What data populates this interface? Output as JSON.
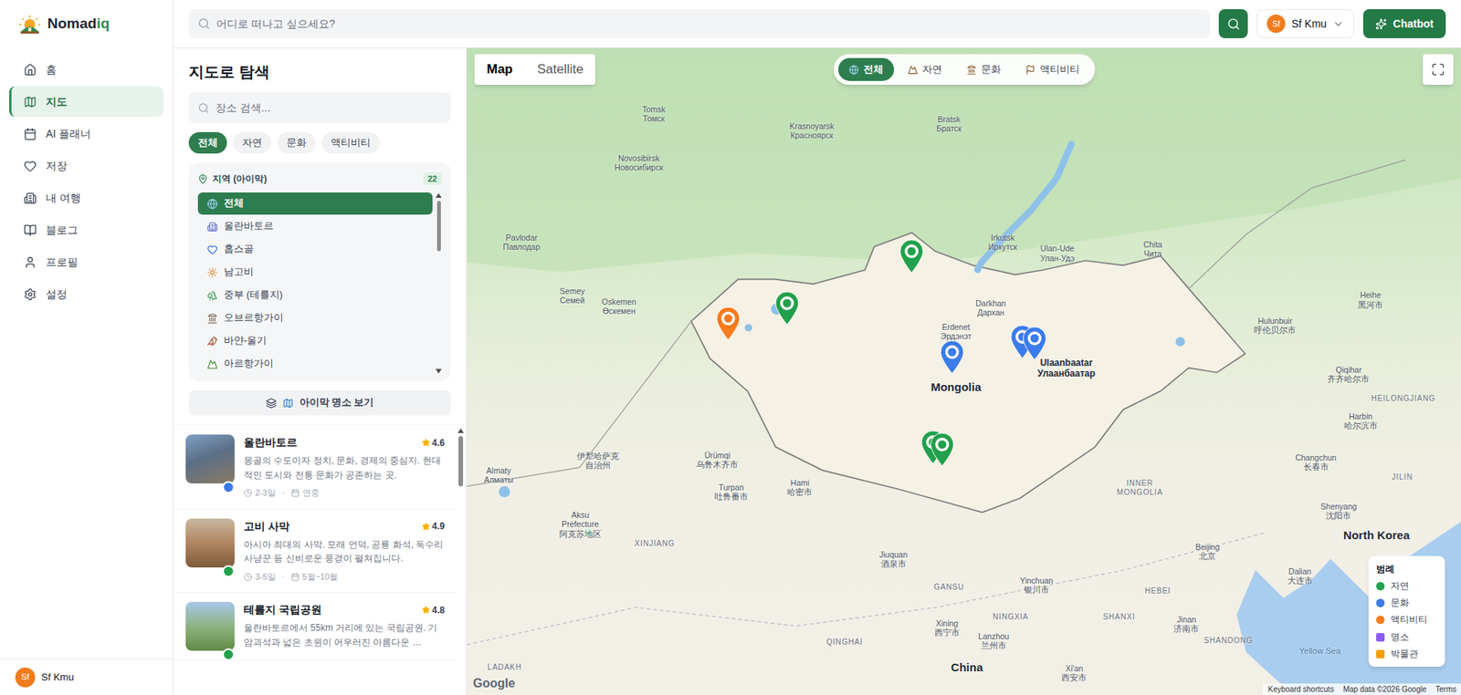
{
  "brand": {
    "name": "Nomad",
    "accent": "iq"
  },
  "nav": [
    {
      "label": "홈",
      "selected": false
    },
    {
      "label": "지도",
      "selected": true
    },
    {
      "label": "AI 플래너",
      "selected": false
    },
    {
      "label": "저장",
      "selected": false
    },
    {
      "label": "내 여행",
      "selected": false
    },
    {
      "label": "블로그",
      "selected": false
    },
    {
      "label": "프로필",
      "selected": false
    },
    {
      "label": "설정",
      "selected": false
    }
  ],
  "sidebar_user": {
    "initials": "Sf",
    "name": "Sf Kmu"
  },
  "topbar": {
    "search_placeholder": "어디로 떠나고 싶으세요?",
    "user": {
      "initials": "Sf",
      "name": "Sf Kmu"
    },
    "chatbot": "Chatbot"
  },
  "panel": {
    "title": "지도로 탐색",
    "search_placeholder": "장소 검색...",
    "filters": [
      {
        "label": "전체",
        "selected": true
      },
      {
        "label": "자연",
        "selected": false
      },
      {
        "label": "문화",
        "selected": false
      },
      {
        "label": "액티비티",
        "selected": false
      }
    ],
    "region": {
      "title": "지역 (아이막)",
      "count": "22",
      "items": [
        {
          "label": "전체",
          "selected": true
        },
        {
          "label": "울란바토르",
          "selected": false
        },
        {
          "label": "홉스골",
          "selected": false
        },
        {
          "label": "남고비",
          "selected": false
        },
        {
          "label": "중부 (테를지)",
          "selected": false
        },
        {
          "label": "오브르항가이",
          "selected": false
        },
        {
          "label": "바얀-울기",
          "selected": false
        },
        {
          "label": "아르항가이",
          "selected": false
        }
      ]
    },
    "aimag_button": "아이막 명소 보기",
    "places": [
      {
        "name": "울란바토르",
        "rating": "4.6",
        "description": "몽골의 수도이자 정치, 문화, 경제의 중심지. 현대적인 도시와 전통 문화가 공존하는 곳.",
        "duration": "2-3일",
        "season": "연중",
        "category_color": "#3b7bea"
      },
      {
        "name": "고비 사막",
        "rating": "4.9",
        "description": "아시아 최대의 사막. 모래 언덕, 공룡 화석, 독수리 사냥꾼 등 신비로운 풍경이 펼쳐집니다.",
        "duration": "3-5일",
        "season": "5월~10월",
        "category_color": "#22a04b"
      },
      {
        "name": "테를지 국립공원",
        "rating": "4.8",
        "description": "울란바토르에서 55km 거리에 있는 국립공원. 기암괴석과 넓은 초원이 어우러진 아름다운 …",
        "category_color": "#22a04b"
      }
    ]
  },
  "map": {
    "types": [
      {
        "label": "Map",
        "selected": true
      },
      {
        "label": "Satellite",
        "selected": false
      }
    ],
    "categories": [
      {
        "label": "전체",
        "selected": true
      },
      {
        "label": "자연",
        "selected": false
      },
      {
        "label": "문화",
        "selected": false
      },
      {
        "label": "액티비티",
        "selected": false
      }
    ],
    "markers": [
      {
        "category": "액티비티",
        "color": "#f57c1f"
      },
      {
        "category": "자연",
        "color": "#22a04b"
      },
      {
        "category": "자연",
        "color": "#22a04b"
      },
      {
        "category": "문화",
        "color": "#3b7bea"
      },
      {
        "category": "문화",
        "color": "#3b7bea"
      },
      {
        "category": "문화",
        "color": "#3b7bea"
      },
      {
        "category": "자연",
        "color": "#22a04b"
      },
      {
        "category": "자연",
        "color": "#22a04b"
      }
    ],
    "labels": [
      {
        "kind": "city",
        "lines": [
          "Tomsk",
          "Томск"
        ]
      },
      {
        "kind": "city",
        "lines": [
          "Krasnoyarsk",
          "Красноярск"
        ]
      },
      {
        "kind": "city",
        "lines": [
          "Bratsk",
          "Братск"
        ]
      },
      {
        "kind": "city",
        "lines": [
          "Novosibirsk",
          "Новосибирск"
        ]
      },
      {
        "kind": "city",
        "lines": [
          "Irkutsk",
          "Иркутск"
        ]
      },
      {
        "kind": "city",
        "lines": [
          "Ulan-Ude",
          "Улан-Удэ"
        ]
      },
      {
        "kind": "city",
        "lines": [
          "Chita",
          "Чита"
        ]
      },
      {
        "kind": "city",
        "lines": [
          "Pavlodar",
          "Павлодар"
        ]
      },
      {
        "kind": "city",
        "lines": [
          "Semey",
          "Семей"
        ]
      },
      {
        "kind": "city",
        "lines": [
          "Oskemen",
          "Өскемен"
        ]
      },
      {
        "kind": "city",
        "lines": [
          "Erdenet",
          "Эрдэнэт"
        ]
      },
      {
        "kind": "city",
        "lines": [
          "Darkhan",
          "Дархан"
        ]
      },
      {
        "kind": "capital",
        "lines": [
          "Ulaanbaatar",
          "Улаанбаатар"
        ]
      },
      {
        "kind": "country",
        "lines": [
          "Mongolia"
        ]
      },
      {
        "kind": "city",
        "lines": [
          "Hulunbuir",
          "呼伦贝尔市"
        ]
      },
      {
        "kind": "city",
        "lines": [
          "Heihe",
          "黑河市"
        ]
      },
      {
        "kind": "city",
        "lines": [
          "Qiqihar",
          "齐齐哈尔市"
        ]
      },
      {
        "kind": "region",
        "lines": [
          "HEILONGJIANG"
        ]
      },
      {
        "kind": "city",
        "lines": [
          "Harbin",
          "哈尔滨市"
        ]
      },
      {
        "kind": "city",
        "lines": [
          "Changchun",
          "长春市"
        ]
      },
      {
        "kind": "region",
        "lines": [
          "JILIN"
        ]
      },
      {
        "kind": "region",
        "lines": [
          "INNER",
          "MONGOLIA"
        ]
      },
      {
        "kind": "city",
        "lines": [
          "Shenyang",
          "沈阳市"
        ]
      },
      {
        "kind": "city",
        "lines": [
          "Almaty",
          "Алматы"
        ]
      },
      {
        "kind": "city",
        "lines": [
          "Ürümqi",
          "乌鲁木齐市"
        ]
      },
      {
        "kind": "city",
        "lines": [
          "伊犁哈萨克",
          "自治州"
        ]
      },
      {
        "kind": "city",
        "lines": [
          "Turpan",
          "吐鲁番市"
        ]
      },
      {
        "kind": "city",
        "lines": [
          "Hami",
          "哈密市"
        ]
      },
      {
        "kind": "city",
        "lines": [
          "Aksu",
          "Prefecture",
          "阿克苏地区"
        ]
      },
      {
        "kind": "region",
        "lines": [
          "XINJIANG"
        ]
      },
      {
        "kind": "city",
        "lines": [
          "Jiuquan",
          "酒泉市"
        ]
      },
      {
        "kind": "region",
        "lines": [
          "GANSU"
        ]
      },
      {
        "kind": "city",
        "lines": [
          "Yinchuan",
          "银川市"
        ]
      },
      {
        "kind": "region",
        "lines": [
          "NINGXIA"
        ]
      },
      {
        "kind": "region",
        "lines": [
          "HEBEI"
        ]
      },
      {
        "kind": "city",
        "lines": [
          "Beijing",
          "北京"
        ]
      },
      {
        "kind": "city",
        "lines": [
          "Dalian",
          "大连市"
        ]
      },
      {
        "kind": "country",
        "lines": [
          "North Korea"
        ]
      },
      {
        "kind": "region",
        "lines": [
          "SHANXI"
        ]
      },
      {
        "kind": "city",
        "lines": [
          "Jinan",
          "济南市"
        ]
      },
      {
        "kind": "region",
        "lines": [
          "SHANDONG"
        ]
      },
      {
        "kind": "city",
        "lines": [
          "Xining",
          "西宁市"
        ]
      },
      {
        "kind": "region",
        "lines": [
          "QINGHAI"
        ]
      },
      {
        "kind": "city",
        "lines": [
          "Lanzhou",
          "兰州市"
        ]
      },
      {
        "kind": "country",
        "lines": [
          "China"
        ]
      },
      {
        "kind": "city",
        "lines": [
          "Xi'an",
          "西安市"
        ]
      },
      {
        "kind": "sea",
        "lines": [
          "Yellow Sea"
        ]
      },
      {
        "kind": "region",
        "lines": [
          "LADAKH"
        ]
      }
    ],
    "legend": {
      "title": "범례",
      "items": [
        {
          "label": "자연",
          "color": "#22a04b",
          "kind": "dot"
        },
        {
          "label": "문화",
          "color": "#3b7bea",
          "kind": "dot"
        },
        {
          "label": "액티비티",
          "color": "#f57c1f",
          "kind": "dot"
        },
        {
          "label": "명소",
          "color": "#8b5cf6",
          "kind": "square"
        },
        {
          "label": "박물관",
          "color": "#f59e0b",
          "kind": "square"
        }
      ]
    },
    "footer": {
      "logo": "Google",
      "links": [
        "Keyboard shortcuts",
        "Map data ©2026 Google",
        "Terms"
      ]
    }
  }
}
